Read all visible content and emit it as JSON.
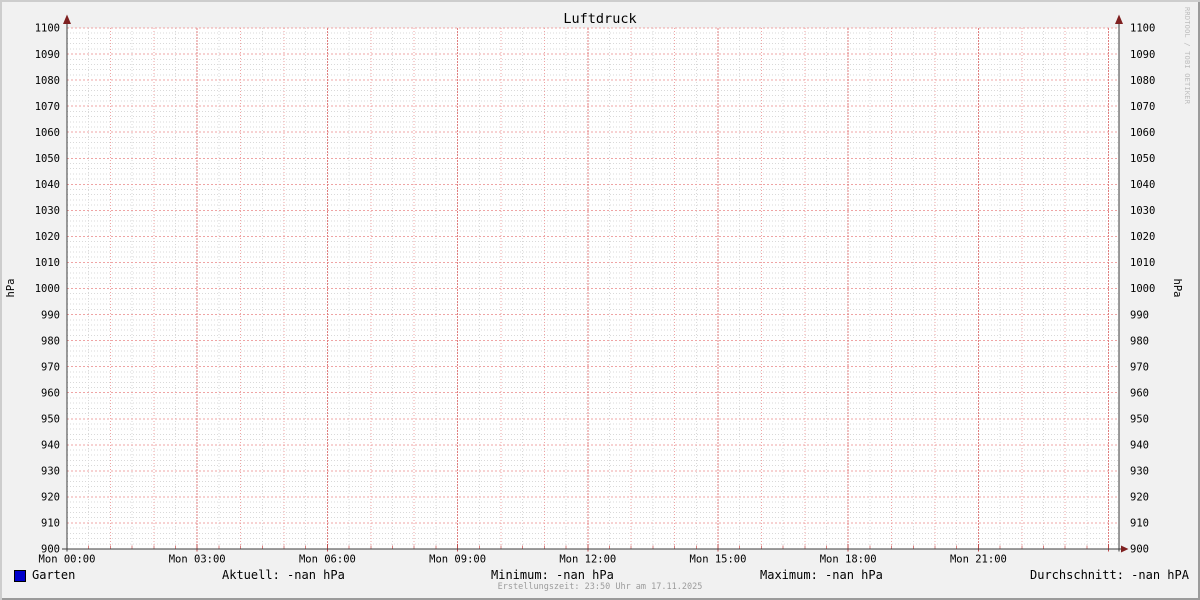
{
  "chart_data": {
    "type": "line",
    "title": "Luftdruck",
    "ylabel_left": "hPa",
    "ylabel_right": "hPa",
    "ylim": [
      900,
      1100
    ],
    "y_major_step": 10,
    "y_minor_step": 2,
    "x_tick_labels": [
      "Mon 00:00",
      "Mon 03:00",
      "Mon 06:00",
      "Mon 09:00",
      "Mon 12:00",
      "Mon 15:00",
      "Mon 18:00",
      "Mon 21:00"
    ],
    "x_span_hours": 24,
    "x_major_every_hours": 3,
    "x_mid_every_hours": 1,
    "x_minor_every_hours": 0.5,
    "grid": true,
    "legend_position": "bottom",
    "series": [
      {
        "name": "Garten",
        "color": "#0000cc",
        "values": []
      }
    ]
  },
  "legend": {
    "series_label": "Garten",
    "swatch_color": "#0000cc",
    "stats": {
      "aktuell": "Aktuell: -nan hPa",
      "minimum": "Minimum: -nan hPa",
      "maximum": "Maximum: -nan hPa",
      "durchschnitt": "Durchschnitt: -nan hPA"
    }
  },
  "footer": {
    "creation_time": "Erstellungszeit: 23:50 Uhr am 17.11.2025"
  },
  "watermark": "RRDTOOL / TOBI OETIKER",
  "colors": {
    "background": "#f1f1f1",
    "canvas": "#ffffff",
    "grid_minor": "#d9d9d9",
    "grid_major": "#efa4a4",
    "grid_major3": "#e08080",
    "tick_minor": "#d87f7f",
    "tick_major": "#c14a4a",
    "axis": "#3c3c3c",
    "arrow": "#7e2020",
    "text": "#000000",
    "muted": "#9c9c9c",
    "watermark": "#bdbdbd"
  }
}
